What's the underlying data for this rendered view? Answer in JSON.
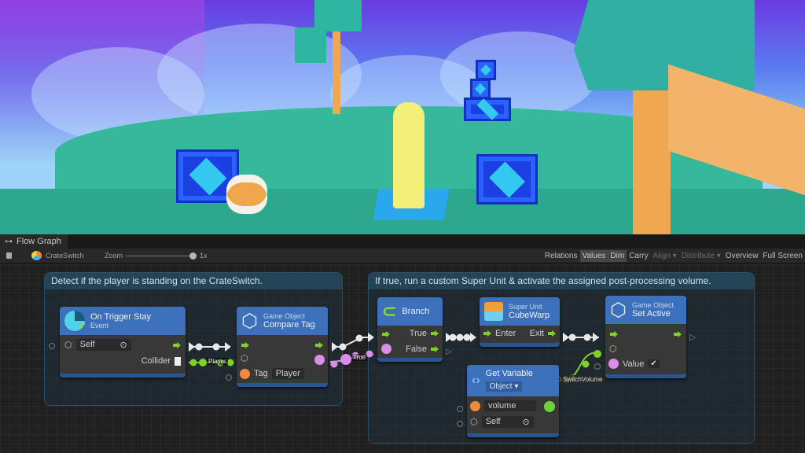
{
  "scene": {
    "description": "3D game viewport: player standing on CrateSwitch pad, blue crates, barrel, trees, wooden deck"
  },
  "panel": {
    "tab_label": "Flow Graph",
    "tab_icon": "hierarchy-icon",
    "toolbar": {
      "asset_name": "CrateSwitch",
      "zoom_label": "Zoom",
      "zoom_value": "1x",
      "zoom_level": 1.0,
      "buttons": [
        {
          "label": "Relations",
          "active": false,
          "enabled": true
        },
        {
          "label": "Values",
          "active": true,
          "enabled": true
        },
        {
          "label": "Dim",
          "active": true,
          "enabled": true
        },
        {
          "label": "Carry",
          "active": false,
          "enabled": true
        },
        {
          "label": "Align ▾",
          "active": false,
          "enabled": false
        },
        {
          "label": "Distribute ▾",
          "active": false,
          "enabled": false
        },
        {
          "label": "Overview",
          "active": false,
          "enabled": true
        },
        {
          "label": "Full Screen",
          "active": false,
          "enabled": true
        }
      ]
    }
  },
  "groups": [
    {
      "title": "Detect if the player is standing on the CrateSwitch."
    },
    {
      "title": "If true, run a custom Super Unit & activate the assigned post-processing volume."
    }
  ],
  "nodes": {
    "on_trigger_stay": {
      "title": "On Trigger Stay",
      "subtitle": "Event",
      "target_value": "Self",
      "output_label": "Collider"
    },
    "compare_tag": {
      "category": "Game Object",
      "title": "Compare Tag",
      "tag_label": "Tag",
      "tag_value": "Player"
    },
    "branch": {
      "title": "Branch",
      "true_label": "True",
      "false_label": "False"
    },
    "cube_warp": {
      "category": "Super Unit",
      "title": "CubeWarp",
      "enter_label": "Enter",
      "exit_label": "Exit"
    },
    "set_active": {
      "category": "Game Object",
      "title": "Set Active",
      "value_label": "Value",
      "value_checked": true,
      "value_check_glyph": "✔"
    },
    "get_variable": {
      "title": "Get Variable",
      "kind": "Object ▾",
      "name_value": "volume",
      "target_value": "Self"
    }
  },
  "wire_labels": {
    "player": "Player",
    "true": "True",
    "switch_volume": "SwitchVolume"
  },
  "colors": {
    "node_header": "#3c70bb",
    "flow": "#7fd12a",
    "bool": "#d98ee8",
    "string": "#f08a3c",
    "object": "#6fcf3a"
  }
}
